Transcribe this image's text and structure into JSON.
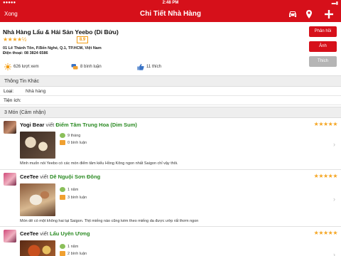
{
  "status": {
    "time": "2:48 PM"
  },
  "nav": {
    "back_label": "Xong",
    "title": "Chi Tiết Nhà Hàng",
    "icons": [
      "car-icon",
      "map-pin-icon",
      "plus-icon"
    ]
  },
  "restaurant": {
    "name": "Nhà Hàng Lẩu & Hải Sản Yeebo (Di Bửu)",
    "stars": "★★★★½",
    "score": "8.9",
    "address": "01 Lê Thánh Tôn, P.Bến Nghé, Q.1, TP.HCM, Việt Nam",
    "phone": "Điện thoại: 08 3824 6586",
    "views": "626 lượt xem",
    "comments": "8 bình luận",
    "likes": "11 thích"
  },
  "buttons": {
    "review": "Phản hồi",
    "photo": "Ảnh",
    "like": "Thích"
  },
  "colors": {
    "brand": "#d6101a",
    "dish": "#2a8a22",
    "star": "#f5a623"
  },
  "other_info": {
    "title": "Thông Tin Khác",
    "type_label": "Loại:",
    "type_value": "Nhà hàng",
    "amenity_label": "Tiện ích:",
    "amenity_value": ""
  },
  "reviews_section": {
    "title": "3 Món (Cảm nhận)"
  },
  "reviews": [
    {
      "user": "Yogi Bear",
      "viet": "viết",
      "dish": "Điểm Tâm Trung Hoa (Dim Sum)",
      "stars": "★★★★★",
      "months": "9 tháng",
      "comments": "0 bình luận",
      "text": "Minh muốn nói Yeebo có các món điểm tâm kiểu Hồng Kông ngon nhất Saigon chỉ vậy thôi."
    },
    {
      "user": "CeeTee",
      "viet": "viết",
      "dish": "Dê Nguội Sơn Đông",
      "stars": "★★★★★",
      "months": "1 năm",
      "comments": "3 bình luận",
      "text": "Món dê có một không hai tại Saigon. Thịt miếng nào cũng kém theo miếng da được ướp rất thơm ngon"
    },
    {
      "user": "CeeTee",
      "viet": "viết",
      "dish": "Lẩu Uyên Ương",
      "stars": "★★★★★",
      "months": "1 năm",
      "comments": "2 bình luận",
      "text": ""
    }
  ]
}
